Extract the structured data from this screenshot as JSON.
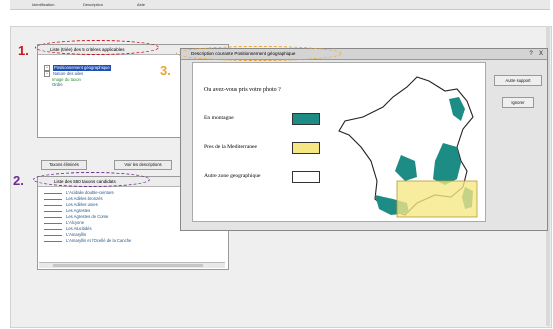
{
  "menu": {
    "items": [
      "Identification",
      "Description",
      "Aide"
    ]
  },
  "left_window": {
    "title": "Liste (triée) des 5 critères applicables",
    "tree": [
      {
        "label": "Positionnement géographique",
        "selected": true,
        "expander": "+",
        "color": "#ffffff"
      },
      {
        "label": "Nature des ailes",
        "selected": false,
        "expander": "+",
        "color": "#225588"
      },
      {
        "label": "Image du taxon",
        "selected": false,
        "expander": "",
        "color": "#2e8b30"
      },
      {
        "label": "Ordre",
        "selected": false,
        "expander": "",
        "color": "#225588"
      }
    ]
  },
  "buttons": {
    "removed_taxa": "Taxons éliminés",
    "see_descriptions": "Voir les descriptions"
  },
  "list_window": {
    "title": "Liste des 550 taxons candidats",
    "items": [
      "L'Acidalie double-ceinture",
      "Les Adèles bronzés",
      "Les Adèles unies",
      "Les Agrestes",
      "Les Agrestes de Corse",
      "L'Alcyone",
      "Les Alucitidés",
      "L'Amaryllis",
      "L'Amaryllis et l'Ocellé de la Canche"
    ]
  },
  "dialog": {
    "title": "Description courante Positionnement géographique",
    "help_glyph": "?",
    "close_glyph": "X",
    "question": "Ou avez-vous pris votre photo ?",
    "options": [
      {
        "label": "En montagne",
        "color": "#1d8c84"
      },
      {
        "label": "Pres de la Mediterranee",
        "color": "#f6e784"
      },
      {
        "label": "Autre zone geographique",
        "color": "#ffffff"
      }
    ],
    "buttons": {
      "other_support": "Autre support",
      "ignore": "Ignorer"
    }
  },
  "annotations": [
    {
      "number": "1.",
      "color": "#c8161d"
    },
    {
      "number": "2.",
      "color": "#6f2c8f"
    },
    {
      "number": "3.",
      "color": "#e8a433"
    }
  ],
  "colors": {
    "mountain": "#1d8c84",
    "mediterranean": "#f6e784",
    "ann1": "#c8161d",
    "ann2": "#6f2c8f",
    "ann3": "#e8a433"
  }
}
